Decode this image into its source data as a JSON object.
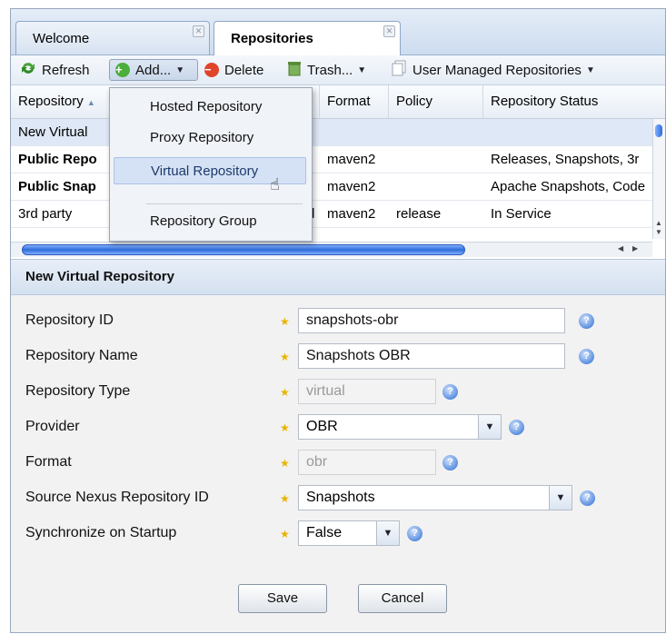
{
  "tabs": [
    {
      "label": "Welcome",
      "active": false
    },
    {
      "label": "Repositories",
      "active": true
    }
  ],
  "toolbar": {
    "refresh": "Refresh",
    "add": "Add...",
    "delete": "Delete",
    "trash": "Trash...",
    "user_managed": "User Managed Repositories"
  },
  "grid": {
    "columns": [
      "Repository",
      "Format",
      "Policy",
      "Repository Status"
    ],
    "rows": [
      {
        "repository": "New Virtual",
        "col2": "",
        "format": "",
        "policy": "",
        "status": "",
        "selected": true,
        "bold": false
      },
      {
        "repository": "Public Repo",
        "col2": "",
        "format": "maven2",
        "policy": "",
        "status": "Releases, Snapshots, 3r",
        "selected": false,
        "bold": true
      },
      {
        "repository": "Public Snap",
        "col2": "",
        "format": "maven2",
        "policy": "",
        "status": "Apache Snapshots, Code",
        "selected": false,
        "bold": true
      },
      {
        "repository": "3rd party",
        "col2": "d",
        "format": "maven2",
        "policy": "release",
        "status": "In Service",
        "selected": false,
        "bold": false
      }
    ]
  },
  "add_menu": {
    "items": [
      "Hosted Repository",
      "Proxy Repository",
      "Virtual Repository",
      "Repository Group"
    ],
    "highlighted": "Virtual Repository"
  },
  "form": {
    "title": "New Virtual Repository",
    "fields": [
      {
        "label": "Repository ID",
        "value": "snapshots-obr",
        "kind": "text"
      },
      {
        "label": "Repository Name",
        "value": "Snapshots OBR",
        "kind": "text"
      },
      {
        "label": "Repository Type",
        "value": "virtual",
        "kind": "disabled"
      },
      {
        "label": "Provider",
        "value": "OBR",
        "kind": "select"
      },
      {
        "label": "Format",
        "value": "obr",
        "kind": "disabled"
      },
      {
        "label": "Source Nexus Repository ID",
        "value": "Snapshots",
        "kind": "select"
      },
      {
        "label": "Synchronize on Startup",
        "value": "False",
        "kind": "select"
      }
    ],
    "save": "Save",
    "cancel": "Cancel"
  },
  "colors": {
    "required_star": "#e8b400",
    "selection": "#dfe8f6",
    "menu_highlight": "#d5e2f5"
  }
}
